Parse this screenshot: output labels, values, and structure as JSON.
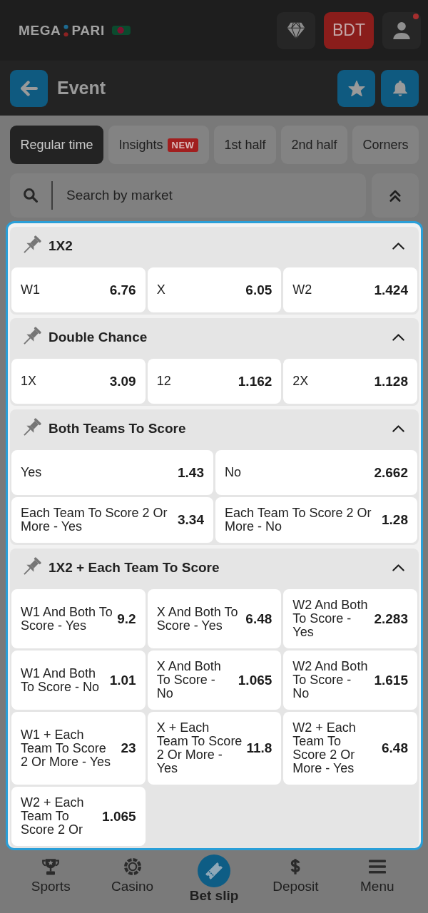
{
  "header": {
    "logo": [
      "MEGA",
      "PARI"
    ],
    "currency": "BDT",
    "account_alert": true
  },
  "event_bar": {
    "title": "Event"
  },
  "tabs": [
    {
      "label": "Regular time",
      "selected": true
    },
    {
      "label": "Insights",
      "badge": "NEW",
      "selected": false
    },
    {
      "label": "1st half",
      "selected": false
    },
    {
      "label": "2nd half",
      "selected": false
    },
    {
      "label": "Corners",
      "selected": false
    }
  ],
  "search": {
    "placeholder": "Search by market"
  },
  "markets": [
    {
      "title": "1X2",
      "expanded": true,
      "rows": [
        [
          {
            "label": "W1",
            "odds": "6.76"
          },
          {
            "label": "X",
            "odds": "6.05"
          },
          {
            "label": "W2",
            "odds": "1.424"
          }
        ]
      ]
    },
    {
      "title": "Double Chance",
      "expanded": true,
      "rows": [
        [
          {
            "label": "1X",
            "odds": "3.09"
          },
          {
            "label": "12",
            "odds": "1.162"
          },
          {
            "label": "2X",
            "odds": "1.128"
          }
        ]
      ]
    },
    {
      "title": "Both Teams To Score",
      "expanded": true,
      "rows": [
        [
          {
            "label": "Yes",
            "odds": "1.43"
          },
          {
            "label": "No",
            "odds": "2.662"
          }
        ],
        [
          {
            "label": "Each Team To Score 2 Or More - Yes",
            "odds": "3.34"
          },
          {
            "label": "Each Team To Score 2 Or More - No",
            "odds": "1.28"
          }
        ]
      ]
    },
    {
      "title": "1X2 + Each Team To Score",
      "expanded": true,
      "rows": [
        [
          {
            "label": "W1 And Both To Score - Yes",
            "odds": "9.2"
          },
          {
            "label": "X And Both To Score - Yes",
            "odds": "6.48"
          },
          {
            "label": "W2 And Both To Score - Yes",
            "odds": "2.283"
          }
        ],
        [
          {
            "label": "W1 And Both To Score - No",
            "odds": "1.01"
          },
          {
            "label": "X And Both To Score - No",
            "odds": "1.065"
          },
          {
            "label": "W2 And Both To Score - No",
            "odds": "1.615"
          }
        ],
        [
          {
            "label": "W1 + Each Team To Score 2 Or More - Yes",
            "odds": "23"
          },
          {
            "label": "X + Each Team To Score 2 Or More - Yes",
            "odds": "11.8"
          },
          {
            "label": "W2 + Each Team To Score 2 Or More - Yes",
            "odds": "6.48"
          }
        ],
        [
          {
            "label": "W2 + Each Team To Score 2 Or",
            "odds": "1.065"
          }
        ]
      ]
    }
  ],
  "bottom_nav": [
    {
      "label": "Sports",
      "selected": false
    },
    {
      "label": "Casino",
      "selected": false
    },
    {
      "label": "Bet slip",
      "selected": true
    },
    {
      "label": "Deposit",
      "selected": false
    },
    {
      "label": "Menu",
      "selected": false
    }
  ]
}
